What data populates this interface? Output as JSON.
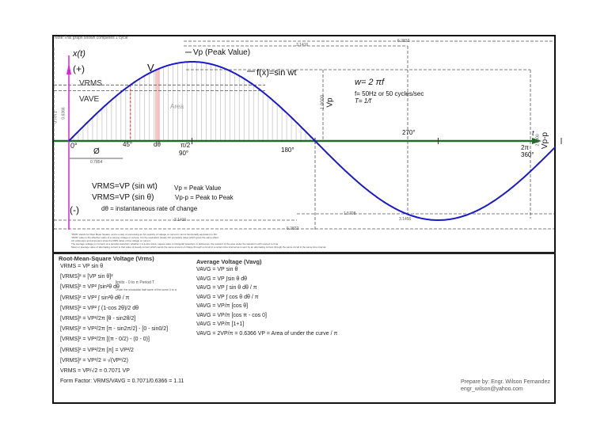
{
  "note": "Note:This graph shown completes 1 cycle",
  "colors": {
    "curve": "#1a1acc",
    "axis": "#1f6b2a",
    "yaxis": "#e020e0",
    "dash": "#555555",
    "red": "#e03030"
  },
  "graph": {
    "xt": "x(t)",
    "plus": "(+)",
    "minus": "(-)",
    "t": "t",
    "vp_peak": "Vp (Peak Value)",
    "fx": "f(x)=sin wt",
    "v": "V",
    "vrms": "VRMS",
    "vave": "VAVE",
    "area": "Area",
    "deg0": "0°",
    "deg45": "45°",
    "dtheta": "dθ",
    "pi2": "π/2",
    "deg90": "90°",
    "deg180": "180°",
    "deg270": "270°",
    "twopi": "2π",
    "deg360": "360°",
    "phi": "Ø",
    "d7854": "0.7854",
    "d31416": "3.1416",
    "d62832": "6.2832",
    "d15708": "1.5708",
    "d0707": "0.7071",
    "d0636": "0.6366",
    "d1000": "1.0000",
    "vp": "Vp",
    "d2000": "2.0000",
    "vpp": "Vp-p",
    "w": "w= 2 πf",
    "f": "f= 50Hz or 50 cycles/sec",
    "T": "T= 1/f",
    "eq1": "VRMS=VP (sin wt)",
    "eq2": "VRMS=VP (sin θ)",
    "vp_def": "Vp = Peak Value",
    "vpp_def": "Vp-p = Peak to Peak",
    "dtheta_def": "dθ = instantaneous rate of change",
    "fine1": "\"RMS\" stands for Root Mean Square, and is a way of expressing an AC quantity of voltage or current in terms functionally equivalent to DC.",
    "fine2": "\"RMS\" value is the effective value of a varying voltage or current. It is the equivalent steady DC (constant) value which gives the same effect.",
    "fine3": "AC voltmeters and ammeters show the RMS value of the voltage or current.",
    "fine4": "The average voltage (or current) of a periodic waveform whether it is a sine wave, square wave or triangular waveform is defined as: the quotient of the area under the waveform with respect to time.",
    "fine5": "Mean or average value of alternating current is that value of steady current which sends the same amount of charge through a circuit in a certain time interval as is sent by an alternating current through the same circuit in the same time interval."
  },
  "rms": {
    "title": "Root-Mean-Square Voltage (Vrms)",
    "lines": [
      "VRMS = VP sin θ",
      "[VRMS]² = [VP sin θ]²",
      "[VRMS]² = VP² ∫sin²θ dθ",
      "[VRMS]² = VP² ∫ sin²θ dθ / π",
      "[VRMS]² = VP² ∫ (1-cos 2θ)/2 dθ",
      "[VRMS]² = VP²/2π [θ - sin2θ/2]",
      "[VRMS]² = VP²/2π [π - sin2π/2] - [0 - sin0/2]",
      "[VRMS]² = VP²/2π [(π - 0/2) - (0 - 0)]",
      "[VRMS]² = VP²/2π [π] = VP²/2",
      "[VRMS]² = VP²/2 = √(VP²/2)",
      "VRMS = VP/√2 = 0.7071 VP",
      "Form Factor: VRMS/VAVG = 0.7071/0.6366 = 1.11"
    ],
    "limits": "limits - 0 to π   Period T",
    "under": "Under the sinusoidal half wave of the curve 0 to π"
  },
  "avg": {
    "title": "Average Voltage (Vavg)",
    "lines": [
      "VAVG = VP sin θ",
      "VAVG = VP ∫sin θ dθ",
      "VAVG = VP ∫ sin θ dθ / π",
      "VAVG = VP ∫ cos θ dθ / π",
      "VAVG = VP/π [cos θ]",
      "VAVG = VP/π [cos π - cos 0]",
      "VAVG = VP/π [1+1]",
      "VAVG = 2VP/π = 0.6366 VP = Area of under the curve / π"
    ]
  },
  "credit": {
    "by": "Prepare by: Engr. Wilson Fernandez",
    "email": "engr_wilson@yahoo.com"
  }
}
